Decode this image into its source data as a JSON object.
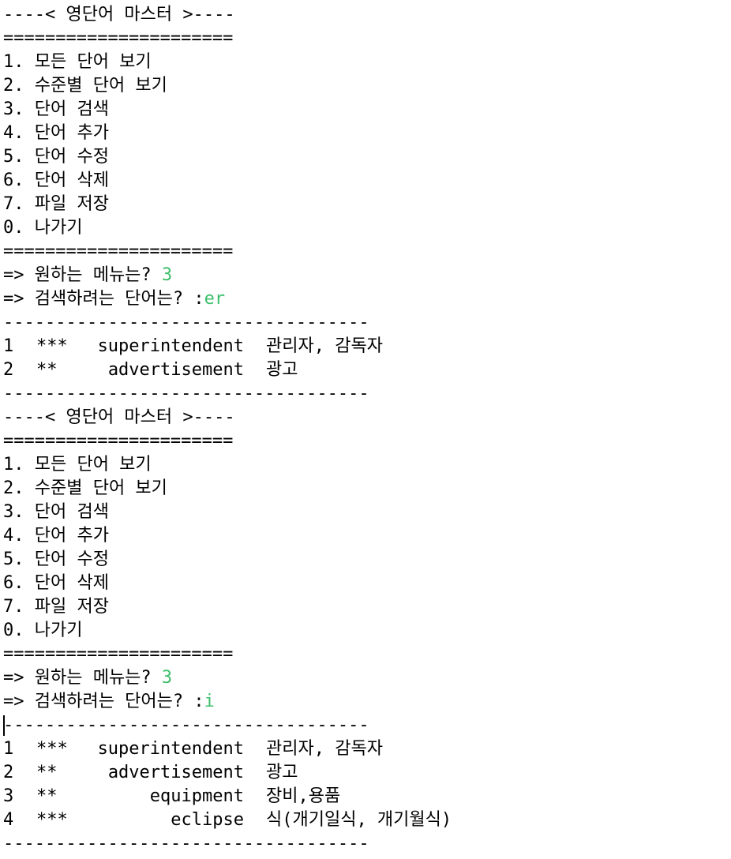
{
  "colors": {
    "background": "#ffffff",
    "text": "#000000",
    "user_input": "#3cbf6a"
  },
  "blocks": [
    {
      "title": "----< 영단어 마스터 >----",
      "separator": "======================",
      "menu": [
        "1. 모든 단어 보기",
        "2. 수준별 단어 보기",
        "3. 단어 검색",
        "4. 단어 추가",
        "5. 단어 수정",
        "6. 단어 삭제",
        "7. 파일 저장",
        "0. 나가기"
      ],
      "separator_end": "======================",
      "menu_prompt": "=> 원하는 메뉴는? ",
      "menu_input": "3",
      "search_prompt": "=> 검색하려는 단어는? :",
      "search_input": "er",
      "rule_top": "-----------------------------------",
      "results": [
        {
          "index": "1",
          "stars": "***",
          "word": "superintendent",
          "meaning": "관리자, 감독자"
        },
        {
          "index": "2",
          "stars": "**",
          "word": "advertisement",
          "meaning": "광고"
        }
      ],
      "rule_bottom": "-----------------------------------"
    },
    {
      "title": "----< 영단어 마스터 >----",
      "separator": "======================",
      "menu": [
        "1. 모든 단어 보기",
        "2. 수준별 단어 보기",
        "3. 단어 검색",
        "4. 단어 추가",
        "5. 단어 수정",
        "6. 단어 삭제",
        "7. 파일 저장",
        "0. 나가기"
      ],
      "separator_end": "======================",
      "menu_prompt": "=> 원하는 메뉴는? ",
      "menu_input": "3",
      "search_prompt": "=> 검색하려는 단어는? :",
      "search_input": "i",
      "rule_top": "-----------------------------------",
      "results": [
        {
          "index": "1",
          "stars": "***",
          "word": "superintendent",
          "meaning": "관리자, 감독자"
        },
        {
          "index": "2",
          "stars": "**",
          "word": "advertisement",
          "meaning": "광고"
        },
        {
          "index": "3",
          "stars": "**",
          "word": "equipment",
          "meaning": "장비,용품"
        },
        {
          "index": "4",
          "stars": "***",
          "word": "eclipse",
          "meaning": "식(개기일식, 개기월식)"
        }
      ],
      "rule_bottom": "-----------------------------------"
    }
  ]
}
